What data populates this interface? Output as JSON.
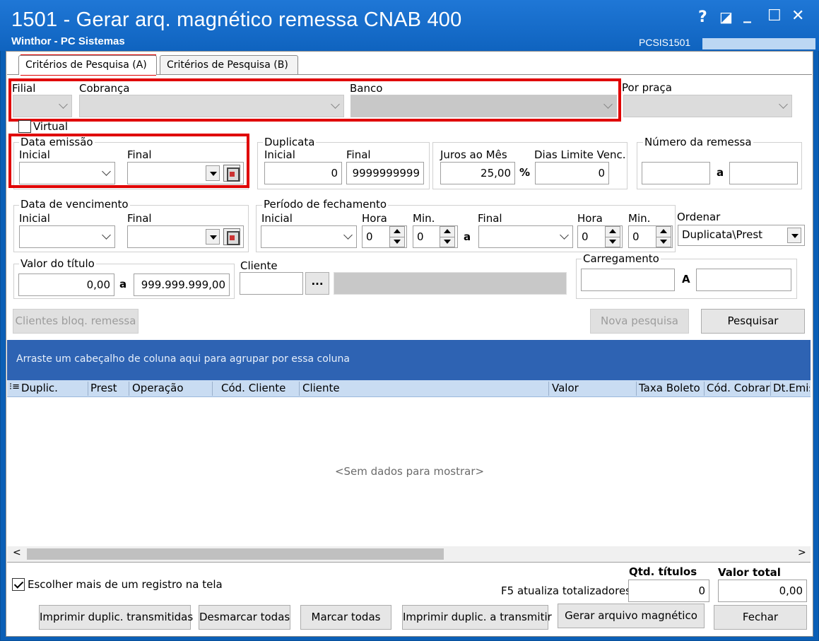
{
  "window": {
    "title": "1501 - Gerar arq. magnético remessa CNAB 400",
    "subtitle": "Winthor - PC Sistemas",
    "code": "PCSIS1501",
    "help_glyph": "?",
    "restore_glyph": "◪",
    "minimize_glyph": "_",
    "maximize_glyph": "☐",
    "close_glyph": "✕"
  },
  "tabs": [
    {
      "label": "Critérios de Pesquisa (A)",
      "active": true
    },
    {
      "label": "Critérios de Pesquisa (B)",
      "active": false
    }
  ],
  "filters": {
    "filial_label": "Filial",
    "cobranca_label": "Cobrança",
    "banco_label": "Banco",
    "por_praca_label": "Por praça",
    "virtual_label": "Virtual",
    "data_emissao": {
      "title": "Data emissão",
      "inicial_label": "Inicial",
      "final_label": "Final"
    },
    "duplicata": {
      "title": "Duplicata",
      "inicial_label": "Inicial",
      "final_label": "Final",
      "inicial": "0",
      "final": "9999999999"
    },
    "juros": {
      "label": "Juros ao Mês",
      "value": "25,00",
      "unit": "%"
    },
    "dias_limite": {
      "label": "Dias Limite Venc.",
      "value": "0"
    },
    "numero_remessa": {
      "title": "Número da remessa",
      "sep": "a"
    },
    "data_vencimento": {
      "title": "Data de vencimento",
      "inicial_label": "Inicial",
      "final_label": "Final"
    },
    "periodo": {
      "title": "Período de fechamento",
      "inicial_label": "Inicial",
      "hora_label": "Hora",
      "min_label": "Min.",
      "sep": "a",
      "final_label": "Final",
      "hora1": "0",
      "min1": "0",
      "hora2": "0",
      "min2": "0"
    },
    "ordenar": {
      "label": "Ordenar",
      "value": "Duplicata\\Prest"
    },
    "valor_titulo": {
      "title": "Valor do título",
      "from": "0,00",
      "sep": "a",
      "to": "999.999.999,00"
    },
    "cliente": {
      "label": "Cliente",
      "ellipsis": "..."
    },
    "carregamento": {
      "title": "Carregamento",
      "sep": "A"
    }
  },
  "actions": {
    "clientes_bloq": "Clientes bloq. remessa",
    "nova_pesquisa": "Nova pesquisa",
    "pesquisar": "Pesquisar"
  },
  "grid": {
    "group_hint": "Arraste um cabeçalho de coluna aqui para agrupar por essa coluna",
    "columns": [
      "Duplic.",
      "Prest",
      "Operação",
      "Cód. Cliente",
      "Cliente",
      "Valor",
      "Taxa Boleto",
      "Cód. Cobrar",
      "Dt.Emis"
    ],
    "empty": "<Sem dados para mostrar>",
    "scroll_left": "<",
    "scroll_right": ">"
  },
  "footer": {
    "escolher_label": "Escolher mais de um registro na tela",
    "escolher_checked": true,
    "qtd_titulos_label": "Qtd. títulos",
    "valor_total_label": "Valor total",
    "f5_label": "F5 atualiza totalizadores",
    "qtd_titulos": "0",
    "valor_total": "0,00"
  },
  "bottom_buttons": {
    "imprimir_transmitidas": "Imprimir duplic. transmitidas",
    "desmarcar": "Desmarcar todas",
    "marcar": "Marcar todas",
    "imprimir_a_transmitir": "Imprimir duplic. a transmitir",
    "gerar": "Gerar arquivo magnético",
    "fechar": "Fechar"
  },
  "colors": {
    "titlebar": "#1f77d6",
    "grid_header": "#2e63b3",
    "highlight": "#e00000"
  }
}
